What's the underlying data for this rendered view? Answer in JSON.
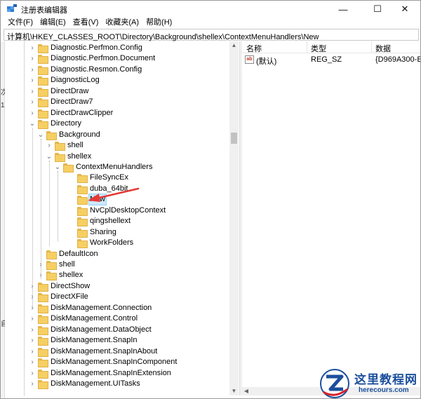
{
  "window": {
    "title": "注册表编辑器",
    "minimize_glyph": "—",
    "maximize_glyph": "☐",
    "close_glyph": "✕"
  },
  "menu": [
    "文件(F)",
    "编辑(E)",
    "查看(V)",
    "收藏夹(A)",
    "帮助(H)"
  ],
  "address": "计算机\\HKEY_CLASSES_ROOT\\Directory\\Background\\shellex\\ContextMenuHandlers\\New",
  "tree": {
    "nodes": [
      {
        "label": "Diagnostic.Perfmon.Config",
        "expander": "›"
      },
      {
        "label": "Diagnostic.Perfmon.Document",
        "expander": "›"
      },
      {
        "label": "Diagnostic.Resmon.Config",
        "expander": "›"
      },
      {
        "label": "DiagnosticLog",
        "expander": "›"
      },
      {
        "label": "DirectDraw",
        "expander": "›"
      },
      {
        "label": "DirectDraw7",
        "expander": "›"
      },
      {
        "label": "DirectDrawClipper",
        "expander": "›"
      },
      {
        "label": "Directory",
        "expander": "⌄"
      },
      {
        "label": "Background",
        "expander": "⌄"
      },
      {
        "label": "shell",
        "expander": "›"
      },
      {
        "label": "shellex",
        "expander": "⌄"
      },
      {
        "label": "ContextMenuHandlers",
        "expander": "⌄"
      },
      {
        "label": "FileSyncEx",
        "expander": ""
      },
      {
        "label": "duba_64bit",
        "expander": ""
      },
      {
        "label": "New",
        "expander": "",
        "selected": true
      },
      {
        "label": "NvCplDesktopContext",
        "expander": ""
      },
      {
        "label": "qingshellext",
        "expander": ""
      },
      {
        "label": "Sharing",
        "expander": ""
      },
      {
        "label": "WorkFolders",
        "expander": ""
      },
      {
        "label": "DefaultIcon",
        "expander": ""
      },
      {
        "label": "shell",
        "expander": "›"
      },
      {
        "label": "shellex",
        "expander": "›"
      },
      {
        "label": "DirectShow",
        "expander": "›"
      },
      {
        "label": "DirectXFile",
        "expander": "›"
      },
      {
        "label": "DiskManagement.Connection",
        "expander": "›"
      },
      {
        "label": "DiskManagement.Control",
        "expander": "›"
      },
      {
        "label": "DiskManagement.DataObject",
        "expander": "›"
      },
      {
        "label": "DiskManagement.SnapIn",
        "expander": "›"
      },
      {
        "label": "DiskManagement.SnapInAbout",
        "expander": "›"
      },
      {
        "label": "DiskManagement.SnapInComponent",
        "expander": "›"
      },
      {
        "label": "DiskManagement.SnapInExtension",
        "expander": "›"
      },
      {
        "label": "DiskManagement.UITasks",
        "expander": "›"
      }
    ]
  },
  "list": {
    "columns": [
      "名称",
      "类型",
      "数据"
    ],
    "rows": [
      {
        "icon": "ab",
        "name": "(默认)",
        "type": "REG_SZ",
        "data": "{D969A300-E"
      }
    ]
  },
  "scroll_glyphs": {
    "up": "▲",
    "down": "▼",
    "left": "◀",
    "right": "▶"
  },
  "edge_fragments": [
    "次",
    "1",
    "自"
  ],
  "watermark": {
    "title": "这里教程网",
    "url": "herecours.com"
  },
  "colors": {
    "selection": "#cce8ff",
    "annotation_arrow": "#e53935",
    "folder": "#f6cf63",
    "watermark": "#1c4f9c"
  }
}
